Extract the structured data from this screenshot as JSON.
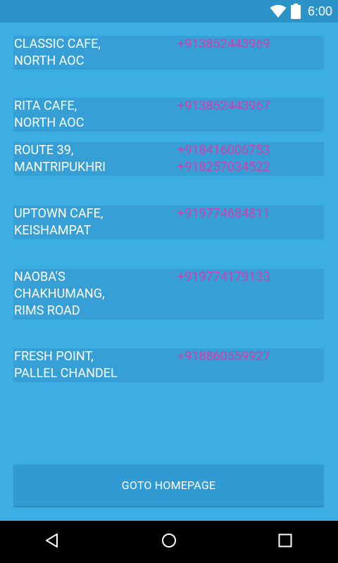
{
  "status_bar": {
    "time": "6:00",
    "icons": [
      "wifi-icon",
      "battery-icon"
    ]
  },
  "cafes": [
    {
      "name": "CLASSIC CAFE,\nNORTH AOC",
      "phones": [
        "+913852443969"
      ]
    },
    {
      "name": "RITA CAFE,\nNORTH AOC",
      "phones": [
        "+913852443967"
      ]
    },
    {
      "name": "ROUTE 39,\nMANTRIPUKHRI",
      "phones": [
        "+918416006753",
        "+918257034522"
      ]
    },
    {
      "name": "UPTOWN CAFE,\nKEISHAMPAT",
      "phones": [
        "+919774684811"
      ]
    },
    {
      "name": "NAOBA'S\nCHAKHUMANG,\nRIMS ROAD",
      "phones": [
        "+919774179133"
      ]
    },
    {
      "name": "FRESH POINT,\nPALLEL CHANDEL",
      "phones": [
        "+918860559927"
      ]
    }
  ],
  "home_button": {
    "label": "GOTO HOMEPAGE"
  },
  "nav_bar": {
    "icons": [
      "back-icon",
      "home-icon",
      "recents-icon"
    ]
  },
  "colors": {
    "background": "#3daee3",
    "row_background": "#359fd6",
    "phone_text": "#d63caf",
    "status_bar": "#2b93c7"
  }
}
